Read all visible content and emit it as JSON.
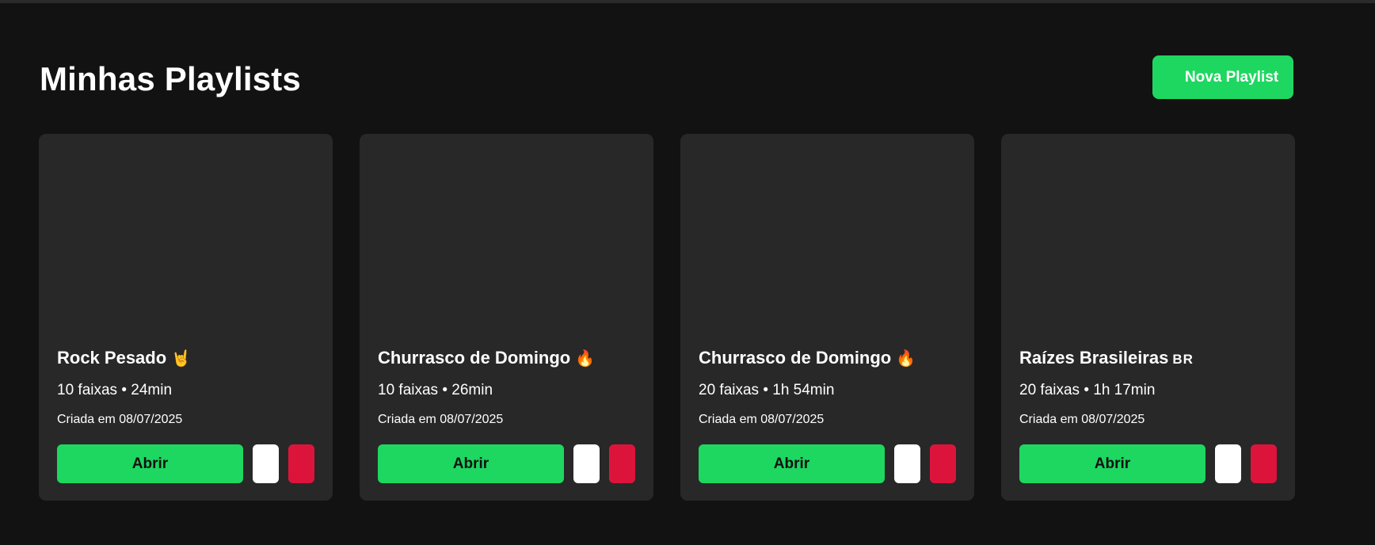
{
  "header": {
    "title": "Minhas Playlists",
    "new_playlist_label": "Nova Playlist"
  },
  "colors": {
    "background": "#121212",
    "card": "#282828",
    "accent": "#1ed760",
    "danger": "#dc143c"
  },
  "playlists": [
    {
      "name": "Rock Pesado",
      "emoji": "🤘",
      "meta": "10 faixas • 24min",
      "created": "Criada em 08/07/2025",
      "open_label": "Abrir"
    },
    {
      "name": "Churrasco de Domingo",
      "emoji": "🔥",
      "meta": "10 faixas • 26min",
      "created": "Criada em 08/07/2025",
      "open_label": "Abrir"
    },
    {
      "name": "Churrasco de Domingo",
      "emoji": "🔥",
      "meta": "20 faixas • 1h 54min",
      "created": "Criada em 08/07/2025",
      "open_label": "Abrir"
    },
    {
      "name": "Raízes Brasileiras",
      "emoji": "BR",
      "meta": "20 faixas • 1h 17min",
      "created": "Criada em 08/07/2025",
      "open_label": "Abrir"
    }
  ]
}
